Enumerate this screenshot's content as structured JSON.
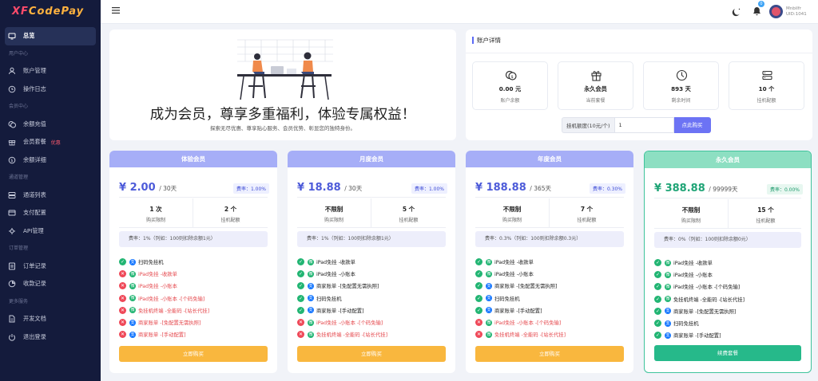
{
  "logo": {
    "part1": "XF",
    "part2": "CodePay"
  },
  "sidebar": {
    "items": [
      {
        "type": "item",
        "label": "总览",
        "icon": "monitor-icon",
        "active": true
      },
      {
        "type": "group",
        "label": "用户中心"
      },
      {
        "type": "item",
        "label": "账户管理",
        "icon": "user-icon"
      },
      {
        "type": "item",
        "label": "操作日志",
        "icon": "log-icon"
      },
      {
        "type": "group",
        "label": "会员中心"
      },
      {
        "type": "item",
        "label": "余额充值",
        "icon": "coins-icon"
      },
      {
        "type": "item",
        "label": "会员套餐",
        "icon": "gift-icon",
        "badge": "优惠"
      },
      {
        "type": "item",
        "label": "余额详细",
        "icon": "detail-icon"
      },
      {
        "type": "group",
        "label": "通道管理"
      },
      {
        "type": "item",
        "label": "通道列表",
        "icon": "list-icon"
      },
      {
        "type": "item",
        "label": "支付配置",
        "icon": "config-icon"
      },
      {
        "type": "item",
        "label": "API管理",
        "icon": "api-icon"
      },
      {
        "type": "group",
        "label": "订单管理"
      },
      {
        "type": "item",
        "label": "订单记录",
        "icon": "order-icon"
      },
      {
        "type": "item",
        "label": "收款记录",
        "icon": "receipt-icon"
      },
      {
        "type": "group",
        "label": "更多服务"
      },
      {
        "type": "item",
        "label": "开发文档",
        "icon": "doc-icon"
      },
      {
        "type": "item",
        "label": "退出登录",
        "icon": "power-icon"
      }
    ]
  },
  "topbar": {
    "notification_count": "0",
    "username": "Mnbilfr UID:1041"
  },
  "banner": {
    "title": "成为会员，尊享多重福利，体验专属权益！",
    "subtitle": "探索无尽优惠、尊享贴心服务、会员优势、彰显您的独特身份。"
  },
  "account": {
    "title": "账户详情",
    "stats": [
      {
        "value": "0.00 元",
        "label": "账户余额",
        "icon": "coin-icon"
      },
      {
        "value": "永久会员",
        "label": "当前套餐",
        "icon": "gift-icon"
      },
      {
        "value": "893 天",
        "label": "剩余时间",
        "icon": "clock-icon"
      },
      {
        "value": "10 个",
        "label": "挂机配额",
        "icon": "server-icon"
      }
    ],
    "buy_label": "挂机额度(10元/个)",
    "buy_value": "1",
    "buy_button": "点此购买"
  },
  "colors": {
    "trial": "#a6aef7",
    "monthly": "#a6aef7",
    "yearly": "#a6aef7",
    "lifetime": "#8ddfc2",
    "accent_blue": "#4d5bd9",
    "accent_green": "#1fa476"
  },
  "plans": [
    {
      "name": "体验会员",
      "price": "¥ 2.00",
      "period": "/ 30天",
      "rate": "费率：1.00%",
      "box1_value": "1 次",
      "box1_label": "购买限制",
      "box2_value": "2 个",
      "box2_label": "挂机配额",
      "note": "费率：1%（列如：100则扣除余额1元）",
      "features": [
        {
          "ok": true,
          "pay": "alipay",
          "text": "扫码免挂机"
        },
        {
          "ok": false,
          "pay": "wechat",
          "text": "iPad免挂 -收款单"
        },
        {
          "ok": false,
          "pay": "wechat",
          "text": "iPad免挂 -小账本"
        },
        {
          "ok": false,
          "pay": "wechat",
          "text": "iPad免挂 -小账本 -[个码免输]"
        },
        {
          "ok": false,
          "pay": "wechat",
          "text": "免挂机终端 -全能码 -[站长代挂]"
        },
        {
          "ok": false,
          "pay": "alipay",
          "text": "商家账单 -[免配置无需执照]"
        },
        {
          "ok": false,
          "pay": "alipay",
          "text": "商家账单 -[手动配置]"
        }
      ],
      "button": "立即购买"
    },
    {
      "name": "月度会员",
      "price": "¥ 18.88",
      "period": "/ 30天",
      "rate": "费率：1.00%",
      "box1_value": "不限制",
      "box1_label": "购买限制",
      "box2_value": "5 个",
      "box2_label": "挂机配额",
      "note": "费率：1%（列如：100则扣除余额1元）",
      "features": [
        {
          "ok": true,
          "pay": "wechat",
          "text": "iPad免挂 -收款单"
        },
        {
          "ok": true,
          "pay": "wechat",
          "text": "iPad免挂 -小账本"
        },
        {
          "ok": true,
          "pay": "alipay",
          "text": "商家账单 -[免配置无需执照]"
        },
        {
          "ok": true,
          "pay": "alipay",
          "text": "扫码免挂机"
        },
        {
          "ok": true,
          "pay": "alipay",
          "text": "商家账单 -[手动配置]"
        },
        {
          "ok": false,
          "pay": "wechat",
          "text": "iPad免挂 -小账本 -[个码免输]"
        },
        {
          "ok": false,
          "pay": "wechat",
          "text": "免挂机终端 -全能码 -[站长代挂]"
        }
      ],
      "button": "立即购买"
    },
    {
      "name": "年度会员",
      "price": "¥ 188.88",
      "period": "/ 365天",
      "rate": "费率：0.30%",
      "box1_value": "不限制",
      "box1_label": "购买限制",
      "box2_value": "7 个",
      "box2_label": "挂机配额",
      "note": "费率：0.3%（列如：100则扣除余额0.3元）",
      "features": [
        {
          "ok": true,
          "pay": "wechat",
          "text": "iPad免挂 -收款单"
        },
        {
          "ok": true,
          "pay": "wechat",
          "text": "iPad免挂 -小账本"
        },
        {
          "ok": true,
          "pay": "alipay",
          "text": "商家账单 -[免配置无需执照]"
        },
        {
          "ok": true,
          "pay": "alipay",
          "text": "扫码免挂机"
        },
        {
          "ok": true,
          "pay": "alipay",
          "text": "商家账单 -[手动配置]"
        },
        {
          "ok": false,
          "pay": "wechat",
          "text": "iPad免挂 -小账本 -[个码免输]"
        },
        {
          "ok": false,
          "pay": "wechat",
          "text": "免挂机终端 -全能码 -[站长代挂]"
        }
      ],
      "button": "立即购买"
    },
    {
      "name": "永久会员",
      "price": "¥ 388.88",
      "period": "/ 99999天",
      "rate": "费率：0.00%",
      "box1_value": "不限制",
      "box1_label": "购买限制",
      "box2_value": "15 个",
      "box2_label": "挂机配额",
      "note": "费率：0%（列如：100则扣除余额0元）",
      "features": [
        {
          "ok": true,
          "pay": "wechat",
          "text": "iPad免挂 -收款单"
        },
        {
          "ok": true,
          "pay": "wechat",
          "text": "iPad免挂 -小账本"
        },
        {
          "ok": true,
          "pay": "wechat",
          "text": "iPad免挂 -小账本 -[个码免输]"
        },
        {
          "ok": true,
          "pay": "wechat",
          "text": "免挂机终端 -全能码 -[站长代挂]"
        },
        {
          "ok": true,
          "pay": "alipay",
          "text": "商家账单 -[免配置无需执照]"
        },
        {
          "ok": true,
          "pay": "alipay",
          "text": "扫码免挂机"
        },
        {
          "ok": true,
          "pay": "alipay",
          "text": "商家账单 -[手动配置]"
        }
      ],
      "button": "续费套餐"
    }
  ]
}
